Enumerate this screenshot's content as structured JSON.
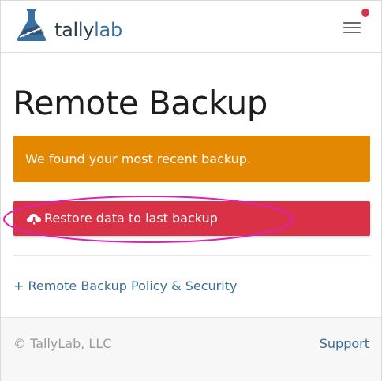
{
  "header": {
    "brand_part1": "tally",
    "brand_part2": "lab",
    "logo_icon": "flask-logo-icon",
    "menu_icon": "hamburger-menu-icon",
    "notification_color": "#d7334a"
  },
  "main": {
    "title": "Remote Backup",
    "alert_text": "We found your most recent backup.",
    "restore_label": "Restore data to last backup",
    "restore_icon": "cloud-download-icon",
    "policy_link": "+ Remote Backup Policy & Security"
  },
  "footer": {
    "copyright": "© TallyLab, LLC",
    "support": "Support"
  },
  "colors": {
    "alert": "#e38800",
    "danger": "#d93246",
    "link": "#3a6b94",
    "annotation": "#e01fb5"
  }
}
